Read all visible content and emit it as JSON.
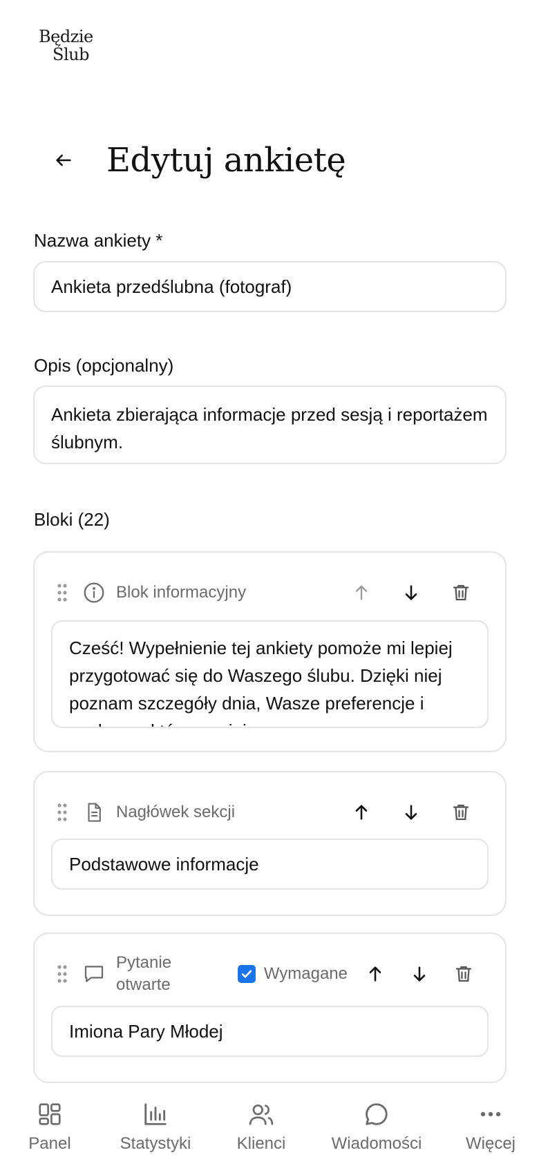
{
  "brand": {
    "line1": "Będzie",
    "line2": "Ślub"
  },
  "header": {
    "title": "Edytuj ankietę"
  },
  "form": {
    "name_label": "Nazwa ankiety *",
    "name_value": "Ankieta przedślubna (fotograf)",
    "desc_label": "Opis (opcjonalny)",
    "desc_value": "Ankieta zbierająca informacje przed sesją i reportażem ślubnym.",
    "blocks_label": "Bloki (22)"
  },
  "blocks": [
    {
      "type_label": "Blok informacyjny",
      "icon": "info-icon",
      "content": "Cześć! Wypełnienie tej ankiety pomoże mi lepiej przygotować się do Waszego ślubu. Dzięki niej poznam szczegóły dnia, Wasze preferencje i osoby, na które powinienem"
    },
    {
      "type_label": "Nagłówek sekcji",
      "icon": "document-icon",
      "content": "Podstawowe informacje"
    },
    {
      "type_label": "Pytanie otwarte",
      "icon": "chat-bubble-icon",
      "required_label": "Wymagane",
      "required": true,
      "content": "Imiona Pary Młodej"
    }
  ],
  "nav": [
    {
      "label": "Panel",
      "icon": "grid-icon"
    },
    {
      "label": "Statystyki",
      "icon": "bar-chart-icon"
    },
    {
      "label": "Klienci",
      "icon": "users-icon"
    },
    {
      "label": "Wiadomości",
      "icon": "message-icon"
    },
    {
      "label": "Więcej",
      "icon": "more-icon"
    }
  ],
  "colors": {
    "accent": "#1a73e8",
    "border": "#e3e3e6",
    "muted": "#6b6b6b"
  }
}
